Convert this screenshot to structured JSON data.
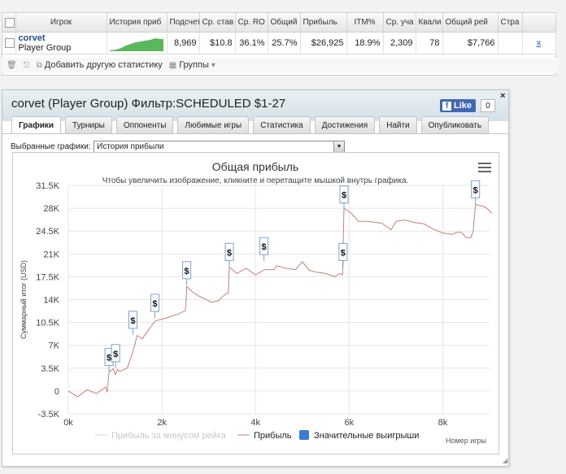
{
  "stats_table": {
    "headers": [
      "Игрок",
      "История приб",
      "Подсчет",
      "Ср. став",
      "Ср. RO",
      "Общий",
      "Прибыль",
      "ITM%",
      "Ср. уча",
      "Квали",
      "Общий рей",
      "Стра"
    ],
    "row": {
      "player": "corvet",
      "group": "Player Group",
      "count": "8,969",
      "avg_stake": "$10.8",
      "avg_roi": "36.1%",
      "total_roi": "25.7%",
      "profit": "$26,925",
      "itm": "18.9%",
      "avg_field": "2,309",
      "qualified": "78",
      "total_rake": "$7,766",
      "country": ""
    },
    "remove": "x"
  },
  "toolbar": {
    "add_stat": "Добавить другую статистику",
    "groups": "Группы",
    "icons": [
      "trash-icon",
      "swap-icon",
      "add-stat-icon",
      "groups-icon"
    ]
  },
  "panel": {
    "title": "corvet (Player Group) Фильтр:SCHEDULED $1-27",
    "like": "Like",
    "like_count": "0",
    "close": "×",
    "tabs": [
      "Графики",
      "Турниры",
      "Оппоненты",
      "Любимые игры",
      "Статистика",
      "Достижения",
      "Найти",
      "Опубликовать"
    ],
    "active_tab": "Графики",
    "chart_select_label": "Выбранные графики:",
    "chart_select_value": "История прибыли"
  },
  "chart_data": {
    "type": "line",
    "title": "Общая прибыль",
    "subtitle": "Чтобы увеличить изображение, кликните и перетащите мышкой внутрь графика.",
    "ylabel": "Суммарный итог (USD)",
    "xlabel": "Номер игры",
    "x_ticks": [
      "0k",
      "2k",
      "4k",
      "6k",
      "8k"
    ],
    "x_range": [
      0,
      9000
    ],
    "y_ticks": [
      "-3.5K",
      "0",
      "3.5K",
      "7K",
      "10.5K",
      "14K",
      "17.5K",
      "21K",
      "24.5K",
      "28K",
      "31.5K"
    ],
    "y_range": [
      -3500,
      31500
    ],
    "grid": true,
    "legend_position": "bottom",
    "series": [
      {
        "name": "Прибыль за минусом рейка",
        "color": "#d9d9d9",
        "visible": false
      },
      {
        "name": "Прибыль",
        "color": "#c08080",
        "points": [
          [
            0,
            0
          ],
          [
            200,
            -900
          ],
          [
            400,
            200
          ],
          [
            600,
            -400
          ],
          [
            800,
            600
          ],
          [
            830,
            -200
          ],
          [
            870,
            2900
          ],
          [
            960,
            3400
          ],
          [
            1010,
            2500
          ],
          [
            1050,
            3300
          ],
          [
            1100,
            3000
          ],
          [
            1260,
            3500
          ],
          [
            1380,
            6000
          ],
          [
            1470,
            8500
          ],
          [
            1580,
            8000
          ],
          [
            1730,
            9500
          ],
          [
            1850,
            10700
          ],
          [
            1950,
            10900
          ],
          [
            2100,
            11200
          ],
          [
            2350,
            11800
          ],
          [
            2500,
            12300
          ],
          [
            2520,
            14000
          ],
          [
            2530,
            16000
          ],
          [
            2650,
            15200
          ],
          [
            2800,
            14500
          ],
          [
            2950,
            14000
          ],
          [
            3050,
            13600
          ],
          [
            3200,
            13800
          ],
          [
            3300,
            14500
          ],
          [
            3420,
            15100
          ],
          [
            3440,
            19000
          ],
          [
            3600,
            18000
          ],
          [
            3800,
            18800
          ],
          [
            4000,
            17800
          ],
          [
            4200,
            18600
          ],
          [
            4400,
            18600
          ],
          [
            4450,
            19200
          ],
          [
            4650,
            18800
          ],
          [
            4850,
            18600
          ],
          [
            5000,
            19800
          ],
          [
            5150,
            18500
          ],
          [
            5300,
            18200
          ],
          [
            5500,
            18000
          ],
          [
            5700,
            17500
          ],
          [
            5800,
            18000
          ],
          [
            5860,
            17800
          ],
          [
            5870,
            22000
          ],
          [
            5890,
            28000
          ],
          [
            6050,
            27200
          ],
          [
            6200,
            26000
          ],
          [
            6400,
            26000
          ],
          [
            6700,
            25700
          ],
          [
            6900,
            24700
          ],
          [
            7000,
            26000
          ],
          [
            7200,
            26200
          ],
          [
            7400,
            25800
          ],
          [
            7600,
            25600
          ],
          [
            7800,
            24800
          ],
          [
            8000,
            24200
          ],
          [
            8200,
            24000
          ],
          [
            8300,
            24300
          ],
          [
            8400,
            24300
          ],
          [
            8500,
            23500
          ],
          [
            8600,
            23500
          ],
          [
            8650,
            24500
          ],
          [
            8700,
            28600
          ],
          [
            8900,
            28200
          ],
          [
            9000,
            27600
          ],
          [
            9050,
            27200
          ]
        ]
      },
      {
        "name": "Значительные выигрыши",
        "color": "#3a7cd5",
        "markers": [
          [
            870,
            2900
          ],
          [
            1010,
            3500
          ],
          [
            1380,
            8600
          ],
          [
            1850,
            11200
          ],
          [
            2530,
            16200
          ],
          [
            3440,
            19000
          ],
          [
            4180,
            19900
          ],
          [
            5870,
            19000
          ],
          [
            5890,
            27800
          ],
          [
            8700,
            28600
          ]
        ]
      }
    ]
  }
}
